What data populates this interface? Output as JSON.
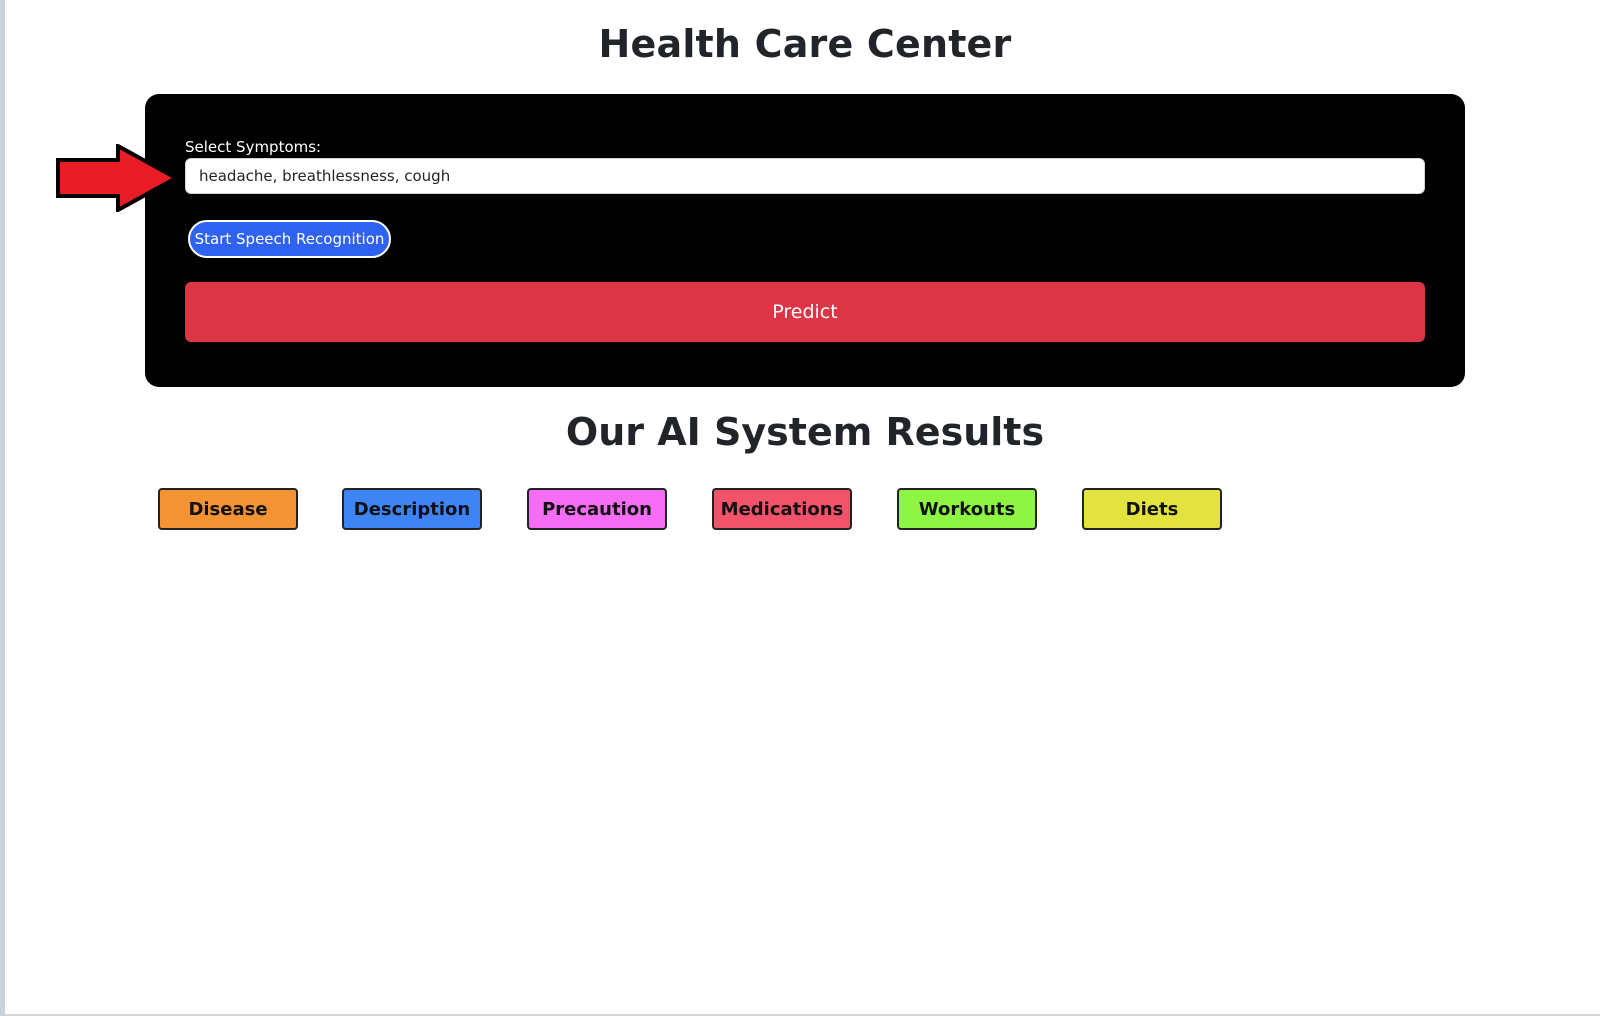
{
  "header": {
    "title": "Health Care Center"
  },
  "form": {
    "symptoms_label": "Select Symptoms:",
    "symptoms_value": "headache, breathlessness, cough",
    "speech_button_label": "Start Speech Recognition",
    "predict_button_label": "Predict"
  },
  "results": {
    "title": "Our AI System Results",
    "buttons": [
      {
        "label": "Disease",
        "color": "#f39334"
      },
      {
        "label": "Description",
        "color": "#3e84f5"
      },
      {
        "label": "Precaution",
        "color": "#f56cf5"
      },
      {
        "label": "Medications",
        "color": "#f2536a"
      },
      {
        "label": "Workouts",
        "color": "#8ef542"
      },
      {
        "label": "Diets",
        "color": "#e2e33e"
      }
    ]
  },
  "annotation": {
    "arrow_icon": "red-arrow-right-icon",
    "arrow_color": "#e81c24"
  },
  "colors": {
    "card_background": "#000000",
    "speech_button": "#2f62f0",
    "predict_button": "#dc3545"
  }
}
